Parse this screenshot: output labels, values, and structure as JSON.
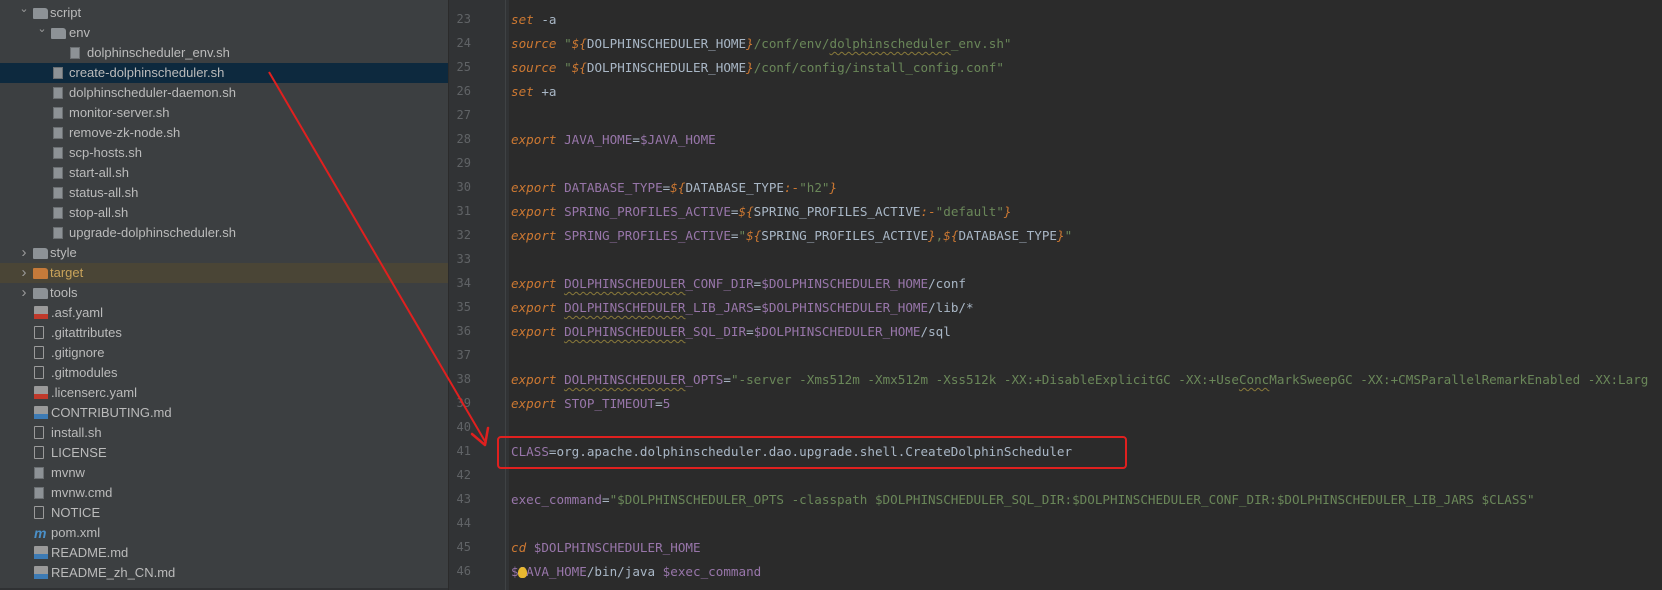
{
  "tree": {
    "items": [
      {
        "label": "script",
        "type": "folder",
        "expanded": true
      },
      {
        "label": "env",
        "type": "folder",
        "expanded": true
      },
      {
        "label": "dolphinscheduler_env.sh",
        "type": "sh"
      },
      {
        "label": "create-dolphinscheduler.sh",
        "type": "sh",
        "selected": true
      },
      {
        "label": "dolphinscheduler-daemon.sh",
        "type": "sh"
      },
      {
        "label": "monitor-server.sh",
        "type": "sh"
      },
      {
        "label": "remove-zk-node.sh",
        "type": "sh"
      },
      {
        "label": "scp-hosts.sh",
        "type": "sh"
      },
      {
        "label": "start-all.sh",
        "type": "sh"
      },
      {
        "label": "status-all.sh",
        "type": "sh"
      },
      {
        "label": "stop-all.sh",
        "type": "sh"
      },
      {
        "label": "upgrade-dolphinscheduler.sh",
        "type": "sh"
      },
      {
        "label": "style",
        "type": "folder",
        "expanded": false
      },
      {
        "label": "target",
        "type": "folder-excluded",
        "expanded": false
      },
      {
        "label": "tools",
        "type": "folder",
        "expanded": false
      },
      {
        "label": ".asf.yaml",
        "type": "yml"
      },
      {
        "label": ".gitattributes",
        "type": "generic"
      },
      {
        "label": ".gitignore",
        "type": "generic"
      },
      {
        "label": ".gitmodules",
        "type": "generic"
      },
      {
        "label": ".licenserc.yaml",
        "type": "yml"
      },
      {
        "label": "CONTRIBUTING.md",
        "type": "md"
      },
      {
        "label": "install.sh",
        "type": "generic"
      },
      {
        "label": "LICENSE",
        "type": "generic"
      },
      {
        "label": "mvnw",
        "type": "sh"
      },
      {
        "label": "mvnw.cmd",
        "type": "sh"
      },
      {
        "label": "NOTICE",
        "type": "generic"
      },
      {
        "label": "pom.xml",
        "type": "maven"
      },
      {
        "label": "README.md",
        "type": "md"
      },
      {
        "label": "README_zh_CN.md",
        "type": "md"
      }
    ]
  },
  "editor": {
    "line_numbers": [
      "23",
      "24",
      "25",
      "26",
      "27",
      "28",
      "29",
      "30",
      "31",
      "32",
      "33",
      "34",
      "35",
      "36",
      "37",
      "38",
      "39",
      "40",
      "41",
      "42",
      "43",
      "44",
      "45",
      "46"
    ],
    "lines": [
      [
        {
          "t": "set",
          "c": "kw"
        },
        {
          "t": " -a"
        }
      ],
      [
        {
          "t": "source",
          "c": "kw"
        },
        {
          "t": " "
        },
        {
          "t": "\"",
          "c": "st"
        },
        {
          "t": "${",
          "c": "kw"
        },
        {
          "t": "DOLPHINSCHEDULER_HOME"
        },
        {
          "t": "}",
          "c": "kw"
        },
        {
          "t": "/conf/env/",
          "c": "st"
        },
        {
          "t": "dolphinscheduler",
          "c": "st squig"
        },
        {
          "t": "_env.sh\"",
          "c": "st"
        }
      ],
      [
        {
          "t": "source",
          "c": "kw"
        },
        {
          "t": " "
        },
        {
          "t": "\"",
          "c": "st"
        },
        {
          "t": "${",
          "c": "kw"
        },
        {
          "t": "DOLPHINSCHEDULER_HOME"
        },
        {
          "t": "}",
          "c": "kw"
        },
        {
          "t": "/conf/config/install_config.conf\"",
          "c": "st"
        }
      ],
      [
        {
          "t": "set",
          "c": "kw"
        },
        {
          "t": " +a"
        }
      ],
      [],
      [
        {
          "t": "export",
          "c": "kw"
        },
        {
          "t": " "
        },
        {
          "t": "JAVA_HOME",
          "c": "vr"
        },
        {
          "t": "="
        },
        {
          "t": "$JAVA_HOME",
          "c": "vr"
        }
      ],
      [],
      [
        {
          "t": "export",
          "c": "kw"
        },
        {
          "t": " "
        },
        {
          "t": "DATABASE_TYPE",
          "c": "vr"
        },
        {
          "t": "="
        },
        {
          "t": "${",
          "c": "kw"
        },
        {
          "t": "DATABASE_TYPE"
        },
        {
          "t": ":-",
          "c": "kw"
        },
        {
          "t": "\"h2\"",
          "c": "st"
        },
        {
          "t": "}",
          "c": "kw"
        }
      ],
      [
        {
          "t": "export",
          "c": "kw"
        },
        {
          "t": " "
        },
        {
          "t": "SPRING_PROFILES_ACTIVE",
          "c": "vr"
        },
        {
          "t": "="
        },
        {
          "t": "${",
          "c": "kw"
        },
        {
          "t": "SPRING_PROFILES_ACTIVE"
        },
        {
          "t": ":-",
          "c": "kw"
        },
        {
          "t": "\"default\"",
          "c": "st"
        },
        {
          "t": "}",
          "c": "kw"
        }
      ],
      [
        {
          "t": "export",
          "c": "kw"
        },
        {
          "t": " "
        },
        {
          "t": "SPRING_PROFILES_ACTIVE",
          "c": "vr"
        },
        {
          "t": "="
        },
        {
          "t": "\"",
          "c": "st"
        },
        {
          "t": "${",
          "c": "kw"
        },
        {
          "t": "SPRING_PROFILES_ACTIVE"
        },
        {
          "t": "}",
          "c": "kw"
        },
        {
          "t": ",",
          "c": "st"
        },
        {
          "t": "${",
          "c": "kw"
        },
        {
          "t": "DATABASE_TYPE"
        },
        {
          "t": "}",
          "c": "kw"
        },
        {
          "t": "\"",
          "c": "st"
        }
      ],
      [],
      [
        {
          "t": "export",
          "c": "kw"
        },
        {
          "t": " "
        },
        {
          "t": "DOLPHINSCHEDULER",
          "c": "vr squig"
        },
        {
          "t": "_CONF_DIR",
          "c": "vr"
        },
        {
          "t": "="
        },
        {
          "t": "$DOLPHINSCHEDULER_HOME",
          "c": "vr"
        },
        {
          "t": "/conf"
        }
      ],
      [
        {
          "t": "export",
          "c": "kw"
        },
        {
          "t": " "
        },
        {
          "t": "DOLPHINSCHEDULER",
          "c": "vr squig"
        },
        {
          "t": "_LIB_JARS",
          "c": "vr"
        },
        {
          "t": "="
        },
        {
          "t": "$DOLPHINSCHEDULER_HOME",
          "c": "vr"
        },
        {
          "t": "/lib/*"
        }
      ],
      [
        {
          "t": "export",
          "c": "kw"
        },
        {
          "t": " "
        },
        {
          "t": "DOLPHINSCHEDULER",
          "c": "vr squig"
        },
        {
          "t": "_SQL_DIR",
          "c": "vr"
        },
        {
          "t": "="
        },
        {
          "t": "$DOLPHINSCHEDULER_HOME",
          "c": "vr"
        },
        {
          "t": "/sql"
        }
      ],
      [],
      [
        {
          "t": "export",
          "c": "kw"
        },
        {
          "t": " "
        },
        {
          "t": "DOLPHINSCHEDULER",
          "c": "vr squig"
        },
        {
          "t": "_OPTS",
          "c": "vr"
        },
        {
          "t": "="
        },
        {
          "t": "\"-server -Xms512m -Xmx512m -Xss512k -XX:+DisableExplicitGC -XX:+Use",
          "c": "st"
        },
        {
          "t": "Conc",
          "c": "st squig"
        },
        {
          "t": "MarkSweepGC -XX:+CMSParallelRemarkEnabled -XX:Larg",
          "c": "st"
        }
      ],
      [
        {
          "t": "export",
          "c": "kw"
        },
        {
          "t": " "
        },
        {
          "t": "STOP_TIMEOUT",
          "c": "vr"
        },
        {
          "t": "="
        },
        {
          "t": "5",
          "c": "vr"
        }
      ],
      [],
      [
        {
          "t": "CLASS",
          "c": "vr"
        },
        {
          "t": "=org.apache.dolphinscheduler.dao.upgrade.shell.CreateDolphinScheduler"
        }
      ],
      [],
      [
        {
          "t": "exec_command",
          "c": "vr"
        },
        {
          "t": "="
        },
        {
          "t": "\"$DOLPHINSCHEDULER_OPTS -classpath $DOLPHINSCHEDULER_SQL_DIR:$DOLPHINSCHEDULER_CONF_DIR:$DOLPHINSCHEDULER_LIB_JARS $CLASS\"",
          "c": "st"
        }
      ],
      [],
      [
        {
          "t": "cd",
          "c": "kw"
        },
        {
          "t": " "
        },
        {
          "t": "$DOLPHINSCHEDULER_HOME",
          "c": "vr"
        }
      ],
      [
        {
          "t": "$",
          "c": "vr"
        },
        {
          "t": "JAVA_HOME",
          "c": "vr"
        },
        {
          "t": "/bin/java "
        },
        {
          "t": "$exec_command",
          "c": "vr"
        }
      ]
    ]
  },
  "colors": {
    "annotation_red": "#e0201f",
    "keyword": "#cc7832",
    "variable": "#9876aa",
    "string": "#6a8759",
    "default_text": "#a9b7c6",
    "selection": "#0d293e"
  }
}
